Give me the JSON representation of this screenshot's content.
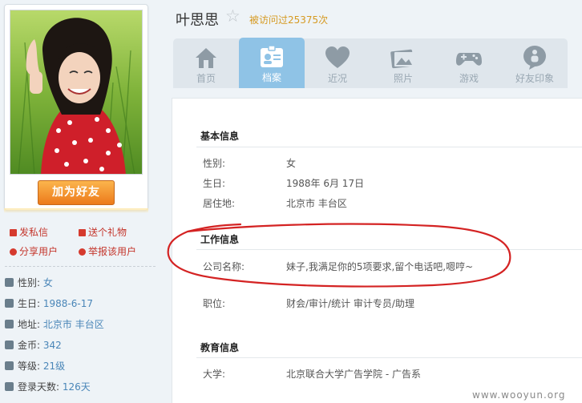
{
  "profile": {
    "name": "叶思思",
    "visits": "被访问过25375次",
    "add_friend": "加为好友"
  },
  "actions": {
    "send_message": "发私信",
    "send_gift": "送个礼物",
    "share": "分享用户",
    "report": "举报该用户"
  },
  "sidebar_info": [
    {
      "label": "性别:",
      "value": "女"
    },
    {
      "label": "生日:",
      "value": "1988-6-17"
    },
    {
      "label": "地址:",
      "value": "北京市 丰台区"
    },
    {
      "label": "金币:",
      "value": "342"
    },
    {
      "label": "等级:",
      "value": "21级"
    },
    {
      "label": "登录天数:",
      "value": "126天"
    }
  ],
  "tabs": [
    {
      "label": "首页",
      "icon": "home-icon"
    },
    {
      "label": "档案",
      "icon": "profile-card-icon",
      "active": true
    },
    {
      "label": "近况",
      "icon": "heart-icon"
    },
    {
      "label": "照片",
      "icon": "photo-icon"
    },
    {
      "label": "游戏",
      "icon": "gamepad-icon"
    },
    {
      "label": "好友印象",
      "icon": "impression-icon"
    }
  ],
  "basic": {
    "title": "基本信息",
    "rows": [
      {
        "label": "性别:",
        "value": "女"
      },
      {
        "label": "生日:",
        "value": "1988年  6月  17日"
      },
      {
        "label": "居住地:",
        "value": "北京市 丰台区"
      }
    ]
  },
  "work": {
    "title": "工作信息",
    "rows": [
      {
        "label": "公司名称:",
        "value": "妹子,我满足你的5项要求,留个电话吧,嗯哼~"
      },
      {
        "label": "职位:",
        "value": "财会/审计/统计  审计专员/助理"
      }
    ]
  },
  "edu": {
    "title": "教育信息",
    "rows": [
      {
        "label": "大学:",
        "value": "北京联合大学广告学院  -  广告系"
      }
    ]
  },
  "watermark": "www.wooyun.org",
  "colors": {
    "accent_blue": "#8fc3e6",
    "link_blue": "#4a86b8",
    "action_red": "#c4352b",
    "visits_orange": "#d69a22",
    "annotation_red": "#d42323"
  }
}
